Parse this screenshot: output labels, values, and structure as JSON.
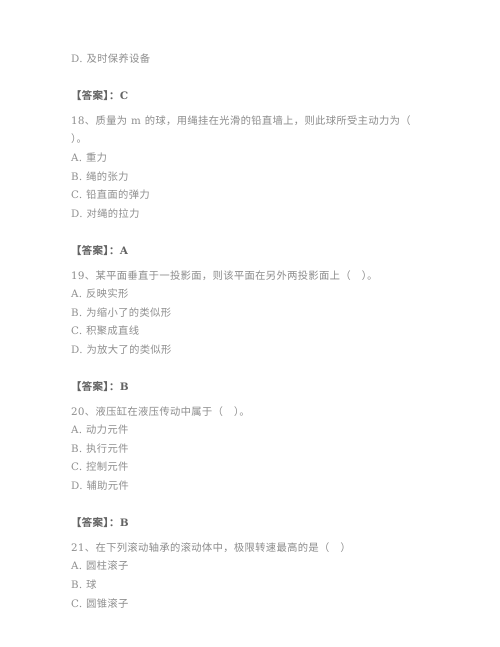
{
  "document": {
    "type": "exam-question-bank",
    "page_background": "#ffffff",
    "text_color": "#8d8d8d",
    "answer_label_color": "#5e5e5e",
    "blocks": [
      {
        "kind": "orphan-option",
        "lines": [
          {
            "role": "option",
            "text": "D. 及时保养设备"
          }
        ]
      },
      {
        "kind": "answer",
        "lines": [
          {
            "role": "answer",
            "text": "【答案】：C"
          }
        ]
      },
      {
        "kind": "question",
        "number": "18",
        "lines": [
          {
            "role": "question",
            "text": "18、质量为 m 的球，用绳挂在光滑的铅直墙上，则此球所受主动力为（"
          },
          {
            "role": "question",
            "text": "）。"
          },
          {
            "role": "option",
            "text": "A. 重力"
          },
          {
            "role": "option",
            "text": "B. 绳的张力"
          },
          {
            "role": "option",
            "text": "C. 铅直面的弹力"
          },
          {
            "role": "option",
            "text": "D. 对绳的拉力"
          }
        ]
      },
      {
        "kind": "answer",
        "lines": [
          {
            "role": "answer",
            "text": "【答案】：A"
          }
        ]
      },
      {
        "kind": "question",
        "number": "19",
        "lines": [
          {
            "role": "question",
            "text": "19、某平面垂直于一投影面，则该平面在另外两投影面上（　）。"
          },
          {
            "role": "option",
            "text": "A. 反映实形"
          },
          {
            "role": "option",
            "text": "B. 为缩小了的类似形"
          },
          {
            "role": "option",
            "text": "C. 积聚成直线"
          },
          {
            "role": "option",
            "text": "D. 为放大了的类似形"
          }
        ]
      },
      {
        "kind": "answer",
        "lines": [
          {
            "role": "answer",
            "text": "【答案】：B"
          }
        ]
      },
      {
        "kind": "question",
        "number": "20",
        "lines": [
          {
            "role": "question",
            "text": "20、液压缸在液压传动中属于（　）。"
          },
          {
            "role": "option",
            "text": "A. 动力元件"
          },
          {
            "role": "option",
            "text": "B. 执行元件"
          },
          {
            "role": "option",
            "text": "C. 控制元件"
          },
          {
            "role": "option",
            "text": "D. 辅助元件"
          }
        ]
      },
      {
        "kind": "answer",
        "lines": [
          {
            "role": "answer",
            "text": "【答案】：B"
          }
        ]
      },
      {
        "kind": "question",
        "number": "21",
        "lines": [
          {
            "role": "question",
            "text": "21、在下列滚动轴承的滚动体中，极限转速最高的是（　）"
          },
          {
            "role": "option",
            "text": "A. 圆柱滚子"
          },
          {
            "role": "option",
            "text": "B. 球"
          },
          {
            "role": "option",
            "text": "C. 圆锥滚子"
          }
        ]
      }
    ]
  }
}
